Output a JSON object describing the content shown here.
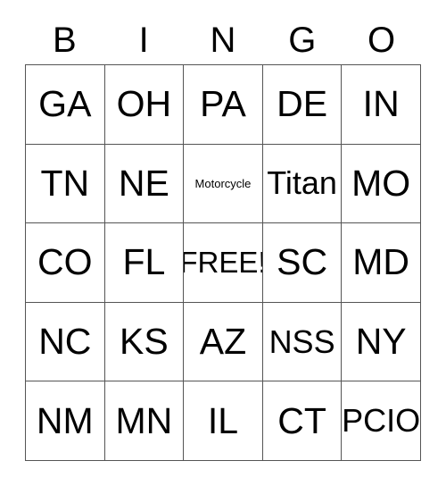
{
  "card": {
    "title": "BINGO",
    "header": [
      "B",
      "I",
      "N",
      "G",
      "O"
    ],
    "border_color": "#555555",
    "text_color": "#000000",
    "background_color": "#ffffff",
    "columns": 5,
    "rows": 5,
    "free_space": {
      "row": 2,
      "column": 2,
      "label": "FREE!"
    },
    "grid": [
      [
        {
          "text": "GA",
          "size": "xl"
        },
        {
          "text": "OH",
          "size": "xl"
        },
        {
          "text": "PA",
          "size": "xl"
        },
        {
          "text": "DE",
          "size": "xl"
        },
        {
          "text": "IN",
          "size": "xl"
        }
      ],
      [
        {
          "text": "TN",
          "size": "xl"
        },
        {
          "text": "NE",
          "size": "xl"
        },
        {
          "text": "Motorcycle",
          "size": "sm"
        },
        {
          "text": "Titan",
          "size": "lg"
        },
        {
          "text": "MO",
          "size": "xl"
        }
      ],
      [
        {
          "text": "CO",
          "size": "xl"
        },
        {
          "text": "FL",
          "size": "xl"
        },
        {
          "text": "FREE!",
          "size": "md"
        },
        {
          "text": "SC",
          "size": "xl"
        },
        {
          "text": "MD",
          "size": "xl"
        }
      ],
      [
        {
          "text": "NC",
          "size": "xl"
        },
        {
          "text": "KS",
          "size": "xl"
        },
        {
          "text": "AZ",
          "size": "xl"
        },
        {
          "text": "NSS",
          "size": "lg"
        },
        {
          "text": "NY",
          "size": "xl"
        }
      ],
      [
        {
          "text": "NM",
          "size": "xl"
        },
        {
          "text": "MN",
          "size": "xl"
        },
        {
          "text": "IL",
          "size": "xl"
        },
        {
          "text": "CT",
          "size": "xl"
        },
        {
          "text": "PCIO",
          "size": "lg"
        }
      ]
    ]
  }
}
